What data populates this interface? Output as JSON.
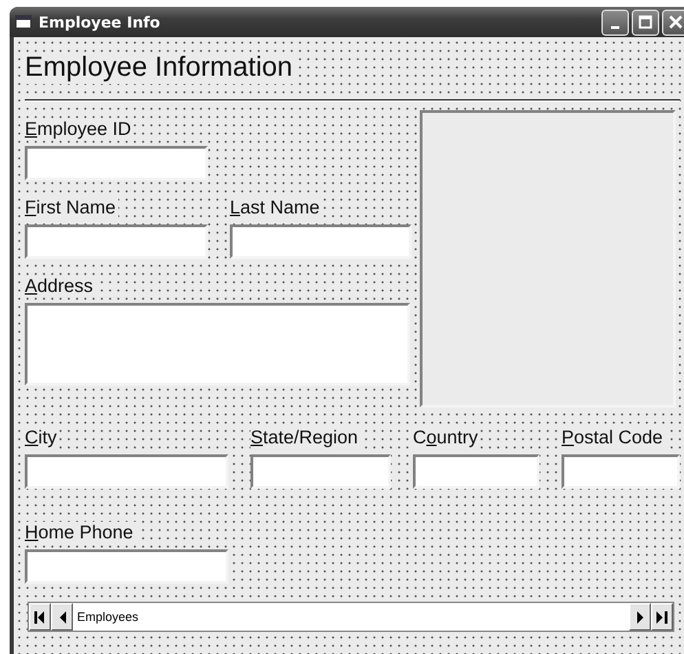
{
  "window": {
    "title": "Employee Info"
  },
  "heading": "Employee Information",
  "upper_rows": [
    [
      {
        "label": {
          "key": "E",
          "post": "mployee ID"
        },
        "kind": "text"
      }
    ],
    [
      {
        "label": {
          "key": "F",
          "post": "irst Name"
        },
        "kind": "text"
      },
      {
        "label": {
          "key": "L",
          "post": "ast Name"
        },
        "kind": "text"
      }
    ],
    [
      {
        "label": {
          "key": "A",
          "post": "ddress"
        },
        "kind": "multiline"
      }
    ]
  ],
  "picture_box": {
    "kind": "image"
  },
  "lower_rows": [
    [
      {
        "label": {
          "key": "C",
          "post": "ity"
        },
        "kind": "text"
      },
      {
        "label": {
          "key": "S",
          "post": "tate/Region"
        },
        "kind": "text"
      },
      {
        "label": {
          "pre": "C",
          "key": "o",
          "post": "untry"
        },
        "kind": "text"
      },
      {
        "label": {
          "key": "P",
          "post": "ostal Code"
        },
        "kind": "text"
      }
    ],
    [
      {
        "label": {
          "key": "H",
          "post": "ome Phone"
        },
        "kind": "text"
      }
    ]
  ],
  "data_control": {
    "caption": "Employees"
  }
}
